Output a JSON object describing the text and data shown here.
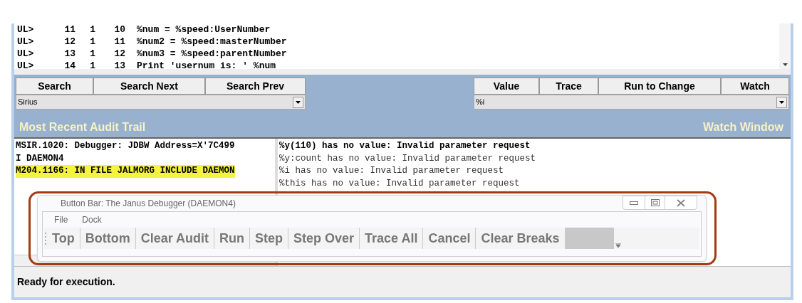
{
  "code_lines": [
    {
      "prompt": "UL>",
      "col_1": "11",
      "col_2": "1",
      "col_3": "10",
      "statement": "%num = %speed:UserNumber"
    },
    {
      "prompt": "UL>",
      "col_1": "12",
      "col_2": "1",
      "col_3": "11",
      "statement": "%num2 = %speed:masterNumber"
    },
    {
      "prompt": "UL>",
      "col_1": "13",
      "col_2": "1",
      "col_3": "12",
      "statement": "%num3 = %speed:parentNumber"
    },
    {
      "prompt": "UL>",
      "col_1": "14",
      "col_2": "1",
      "col_3": "13",
      "statement": "Print 'usernum is: ' %num"
    }
  ],
  "search_buttons": [
    "Search",
    "Search Next",
    "Search Prev"
  ],
  "search_dropdown": {
    "value": "Sirius"
  },
  "watch_buttons": [
    "Value",
    "Trace",
    "Run to Change",
    "Watch"
  ],
  "watch_dropdown": {
    "value": "%i"
  },
  "audit_title": "Most Recent Audit Trail",
  "watch_title": "Watch Window",
  "audit_lines": [
    {
      "text": "MSIR.1020: Debugger: JDBW Address=X'7C499",
      "highlighted": false
    },
    {
      "text": "I DAEMON4",
      "highlighted": false
    },
    {
      "text": "M204.1166: IN FILE JALMORG INCLUDE DAEMON",
      "highlighted": true
    }
  ],
  "watch_lines": [
    "%y(110) has no value: Invalid parameter request",
    "%y:count has no value: Invalid parameter request",
    "%i has no value: Invalid parameter request",
    "%this has no value: Invalid parameter request"
  ],
  "button_bar": {
    "title": "Button Bar: The Janus Debugger (DAEMON4)",
    "menu": [
      "File",
      "Dock"
    ],
    "buttons": [
      "Top",
      "Bottom",
      "Clear Audit",
      "Run",
      "Step",
      "Step Over",
      "Trace All",
      "Cancel",
      "Clear Breaks"
    ]
  },
  "status": "Ready for execution."
}
